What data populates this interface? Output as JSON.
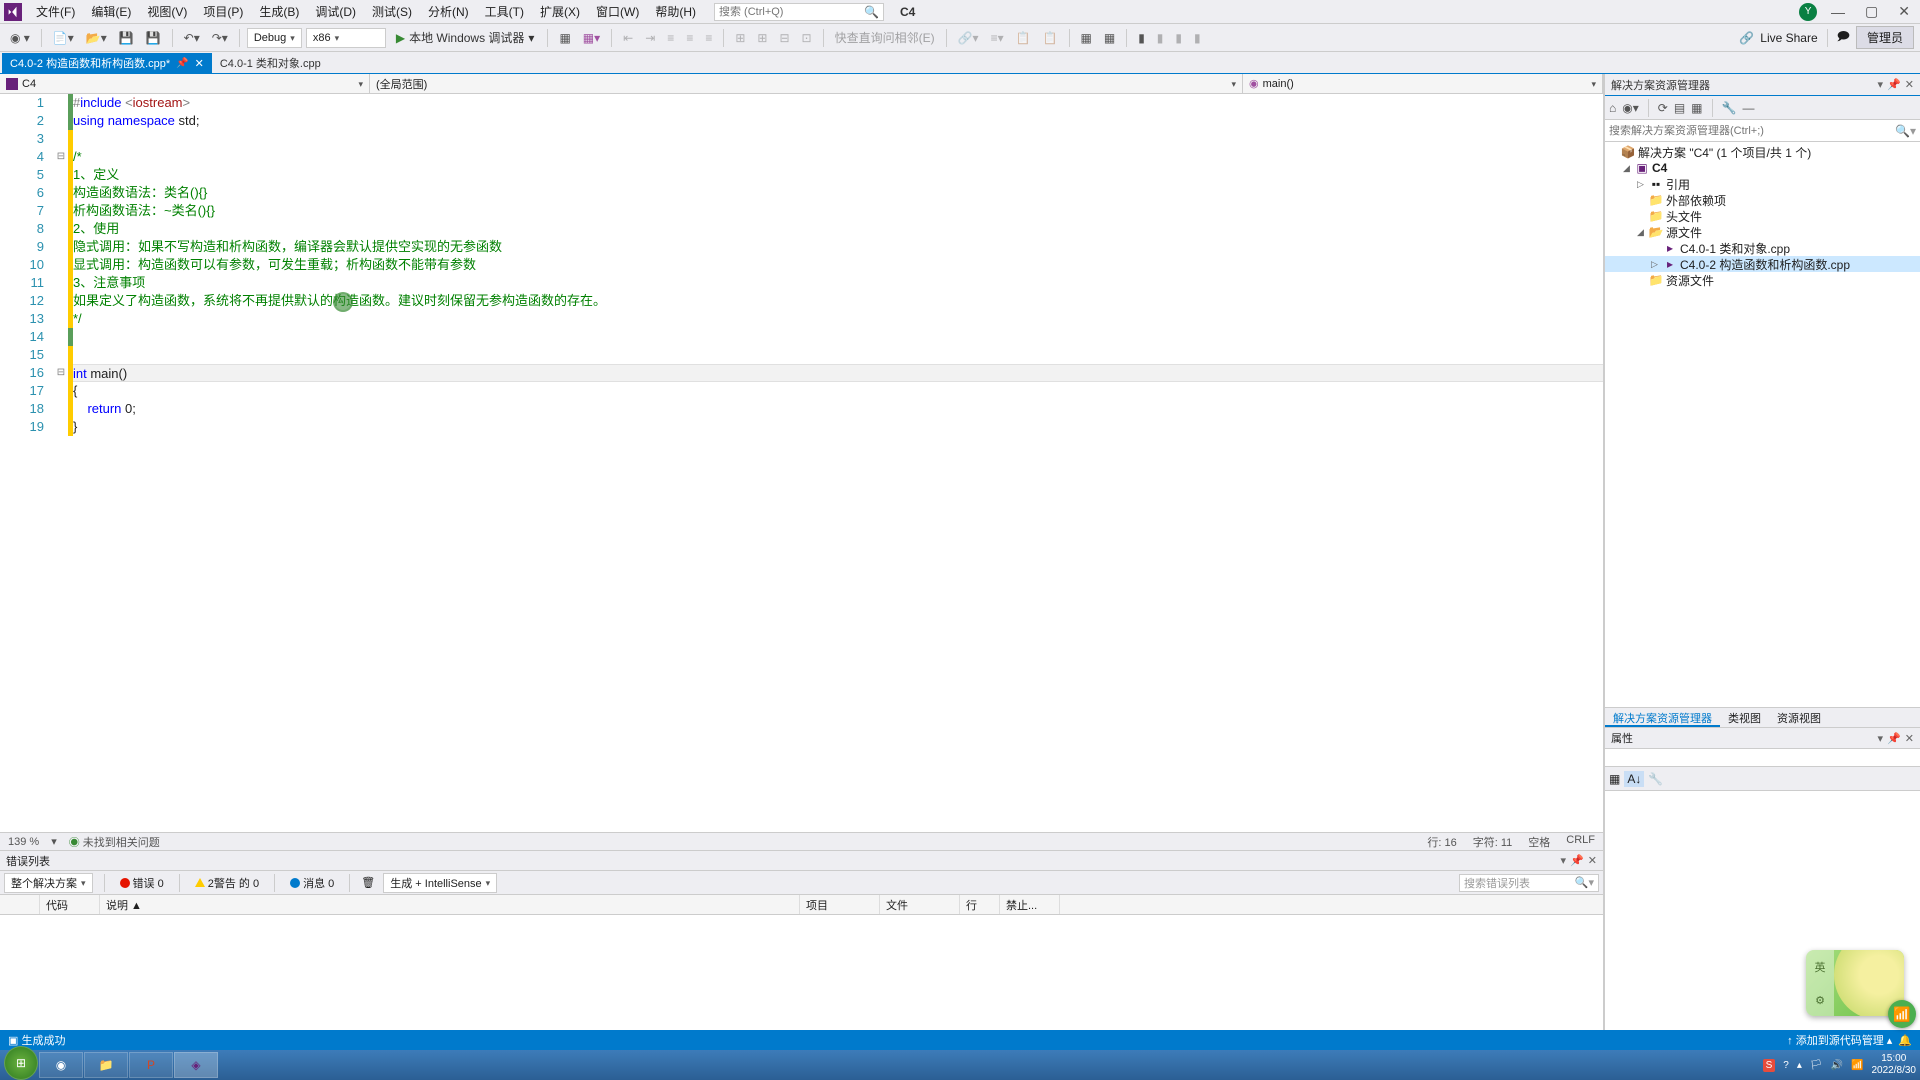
{
  "menu": [
    "文件(F)",
    "编辑(E)",
    "视图(V)",
    "项目(P)",
    "生成(B)",
    "调试(D)",
    "测试(S)",
    "分析(N)",
    "工具(T)",
    "扩展(X)",
    "窗口(W)",
    "帮助(H)"
  ],
  "search_placeholder": "搜索 (Ctrl+Q)",
  "project_name": "C4",
  "avatar_letter": "Y",
  "toolbar": {
    "config": "Debug",
    "platform": "x86",
    "run_label": "本地 Windows 调试器",
    "quick_replace": "快查直询问相邻(E)",
    "live_share": "Live Share",
    "admin": "管理员"
  },
  "tabs": [
    {
      "label": "C4.0-2 构造函数和析构函数.cpp*",
      "active": true
    },
    {
      "label": "C4.0-1 类和对象.cpp",
      "active": false
    }
  ],
  "context": {
    "scope1": "C4",
    "scope2": "(全局范围)",
    "scope3": "main()"
  },
  "code_lines": [
    {
      "n": 1,
      "html": "<span class='pp'>#</span><span class='pp-kw'>include</span> <span class='pp'>&lt;</span><span class='str'>iostream</span><span class='pp'>&gt;</span>"
    },
    {
      "n": 2,
      "html": "<span class='kw'>using</span> <span class='kw'>namespace</span> std;"
    },
    {
      "n": 3,
      "html": ""
    },
    {
      "n": 4,
      "html": "<span class='cmt'>/*</span>"
    },
    {
      "n": 5,
      "html": "<span class='cmt'>1、定义</span>"
    },
    {
      "n": 6,
      "html": "<span class='cmt'>构造函数语法：类名(){}</span>"
    },
    {
      "n": 7,
      "html": "<span class='cmt'>析构函数语法：~类名(){}</span>"
    },
    {
      "n": 8,
      "html": "<span class='cmt'>2、使用</span>"
    },
    {
      "n": 9,
      "html": "<span class='cmt'>隐式调用：如果不写构造和析构函数，编译器会默认提供空实现的无参函数</span>"
    },
    {
      "n": 10,
      "html": "<span class='cmt'>显式调用：构造函数可以有参数，可发生重载；析构函数不能带有参数</span>"
    },
    {
      "n": 11,
      "html": "<span class='cmt'>3、注意事项</span>"
    },
    {
      "n": 12,
      "html": "<span class='cmt'>如果定义了构造函数，系统将不再提供默认的构造函数。建议时刻保留无参构造函数的存在。</span>"
    },
    {
      "n": 13,
      "html": "<span class='cmt'>*/</span>"
    },
    {
      "n": 14,
      "html": ""
    },
    {
      "n": 15,
      "html": ""
    },
    {
      "n": 16,
      "html": "<span class='kw'>int</span> main()",
      "cur": true
    },
    {
      "n": 17,
      "html": "{"
    },
    {
      "n": 18,
      "html": "    <span class='kw'>return</span> 0;"
    },
    {
      "n": 19,
      "html": "}"
    }
  ],
  "editor_status": {
    "zoom": "139 %",
    "issues": "未找到相关问题",
    "line": "行: 16",
    "col": "字符: 11",
    "spaces": "空格",
    "eol": "CRLF"
  },
  "error_panel": {
    "title": "错误列表",
    "scope": "整个解决方案",
    "errors": "错误 0",
    "warnings": "2警告 的 0",
    "messages": "消息 0",
    "build": "生成 + IntelliSense",
    "search": "搜索错误列表",
    "cols": [
      "",
      "代码",
      "说明 ▲",
      "项目",
      "文件",
      "行",
      "禁止..."
    ]
  },
  "solution": {
    "title": "解决方案资源管理器",
    "search": "搜索解决方案资源管理器(Ctrl+;)",
    "root": "解决方案 \"C4\" (1 个项目/共 1 个)",
    "project": "C4",
    "refs": "引用",
    "ext_deps": "外部依赖项",
    "headers": "头文件",
    "sources": "源文件",
    "file1": "C4.0-1 类和对象.cpp",
    "file2": "C4.0-2 构造函数和析构函数.cpp",
    "resources": "资源文件",
    "tabs": [
      "解决方案资源管理器",
      "类视图",
      "资源视图"
    ],
    "props_title": "属性"
  },
  "statusbar": {
    "build": "生成成功",
    "source_control": "添加到源代码管理"
  },
  "clock": {
    "time": "15:00",
    "date": "2022/8/30"
  }
}
